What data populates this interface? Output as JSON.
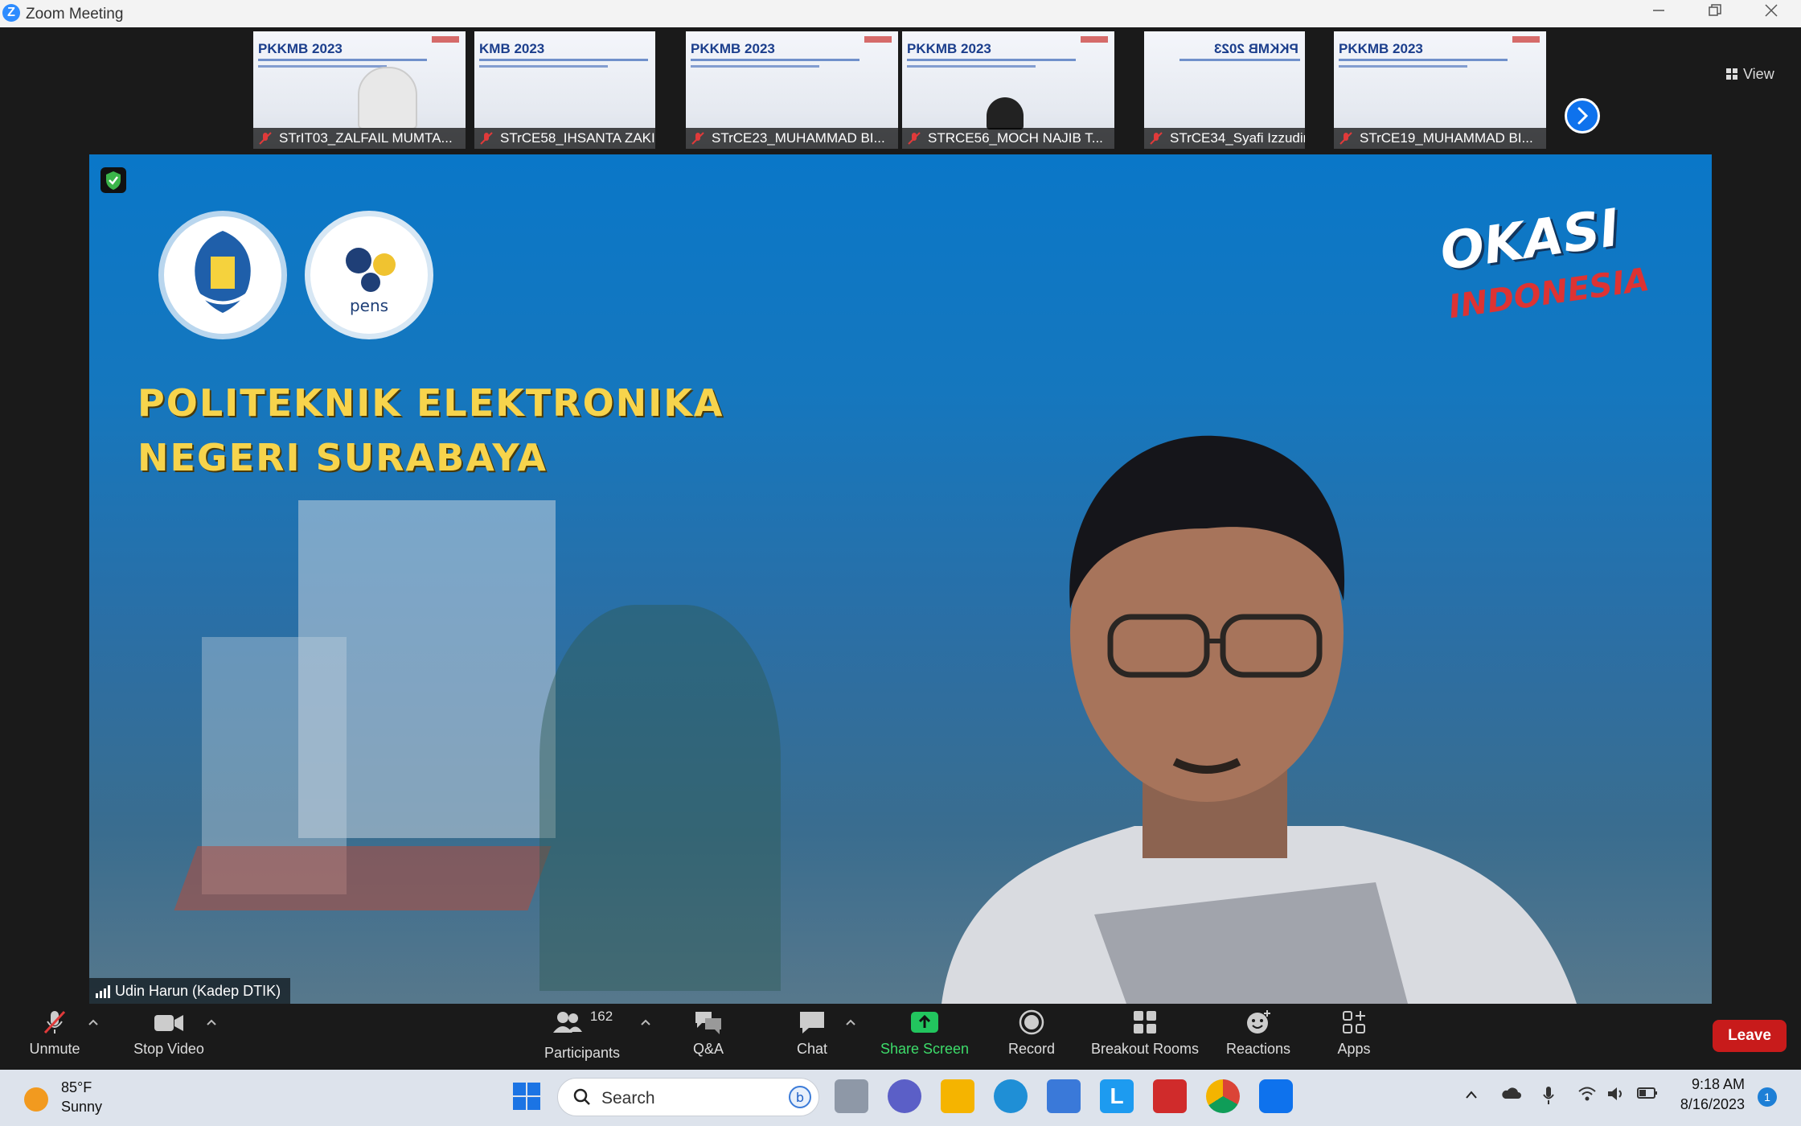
{
  "window": {
    "title": "Zoom Meeting",
    "app_icon": "Z"
  },
  "strip": {
    "view_label": "View",
    "thumbnails": [
      {
        "name": "STrIT03_ZALFAIL MUMTA...",
        "slide_title": "PKKMB 2023"
      },
      {
        "name": "STrCE58_IHSANTA ZAKI",
        "slide_title": "KMB 2023"
      },
      {
        "name": "STrCE23_MUHAMMAD BI...",
        "slide_title": "PKKMB 2023"
      },
      {
        "name": "STRCE56_MOCH NAJIB T...",
        "slide_title": "PKKMB 2023"
      },
      {
        "name": "STrCE34_Syafi Izzudin",
        "slide_title": "PKKMB 2023"
      },
      {
        "name": "STrCE19_MUHAMMAD BI...",
        "slide_title": "PKKMB 2023"
      }
    ]
  },
  "stage": {
    "institution_line1": "POLITEKNIK ELEKTRONIKA",
    "institution_line2": "NEGERI SURABAYA",
    "logo_right": "OKASI",
    "logo_right_sub": "INDONESIA",
    "speaker_label": "Udin Harun (Kadep DTIK)"
  },
  "controls": {
    "unmute": "Unmute",
    "stop_video": "Stop Video",
    "participants": "Participants",
    "participants_count": "162",
    "qa": "Q&A",
    "chat": "Chat",
    "share_screen": "Share Screen",
    "record": "Record",
    "breakout_rooms": "Breakout Rooms",
    "reactions": "Reactions",
    "apps": "Apps",
    "leave": "Leave"
  },
  "taskbar": {
    "weather_temp": "85°F",
    "weather_cond": "Sunny",
    "search_placeholder": "Search",
    "time": "9:18 AM",
    "date": "8/16/2023",
    "notifications": "1"
  },
  "colors": {
    "zoom_blue": "#0e72ed",
    "leave_red": "#c81b1b",
    "share_green": "#22c55e"
  }
}
